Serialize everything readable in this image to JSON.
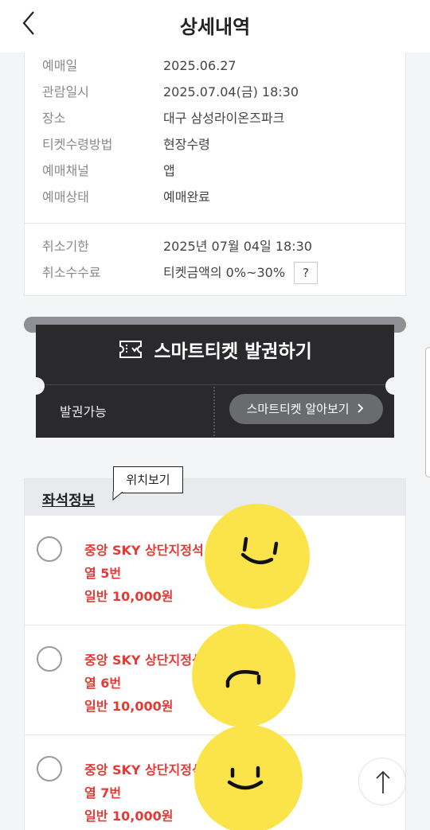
{
  "header": {
    "title": "상세내역",
    "back_icon": "chevron-left-icon"
  },
  "info": {
    "rows": [
      {
        "label": "예매일",
        "value": "2025.06.27"
      },
      {
        "label": "관람일시",
        "value": "2025.07.04(금) 18:30"
      },
      {
        "label": "장소",
        "value": "대구 삼성라이온즈파크"
      },
      {
        "label": "티켓수령방법",
        "value": "현장수령"
      },
      {
        "label": "예매채널",
        "value": "앱"
      },
      {
        "label": "예매상태",
        "value": "예매완료"
      }
    ],
    "cancel_rows": [
      {
        "label": "취소기한",
        "value": "2025년 07월 04일 18:30"
      },
      {
        "label": "취소수수료",
        "value": "티켓금액의 0%~30%"
      }
    ],
    "help_label": "?"
  },
  "ticket": {
    "title": "스마트티켓 발권하기",
    "status": "발권가능",
    "info_button": "스마트티켓 알아보기",
    "info_button_icon": "chevron-right-icon",
    "icon": "ticket-icon"
  },
  "seat": {
    "section_title": "좌석정보",
    "tooltip": "위치보기",
    "items": [
      {
        "zone": "중앙 SKY 상단지정석",
        "seat": "열 5번",
        "price": "일반 10,000원"
      },
      {
        "zone": "중앙 SKY 상단지정석",
        "seat": "열 6번",
        "price": "일반 10,000원"
      },
      {
        "zone": "중앙 SKY 상단지정석",
        "seat": "열 7번",
        "price": "일반 10,000원"
      }
    ]
  },
  "colors": {
    "accent_red": "#e53935",
    "ticket_bg": "#2a2a2c",
    "sticker_yellow": "#fbe44a"
  },
  "scroll_top_icon": "arrow-up-icon"
}
